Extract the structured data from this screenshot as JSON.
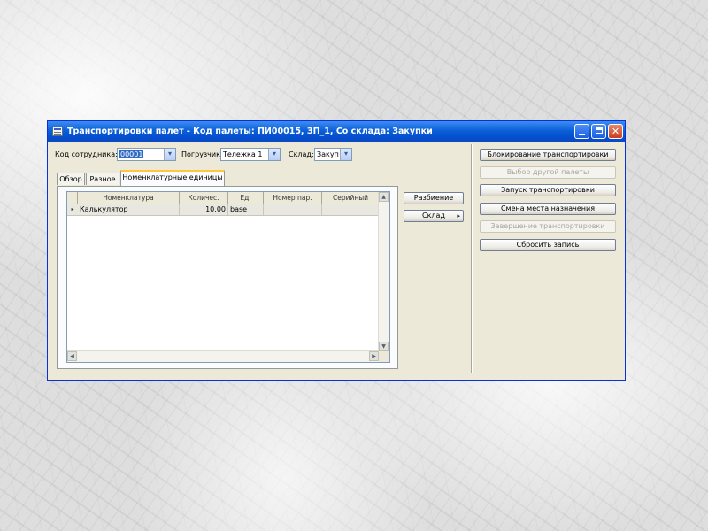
{
  "window": {
    "title": "Транспортировки палет - Код палеты: ПИ00015, ЗП_1, Со склада: Закупки",
    "min_label": "",
    "max_label": "",
    "close_label": "✕"
  },
  "filters": {
    "code_label": "Код сотрудника:",
    "code_value": "00001",
    "loader_label": "Погрузчик:",
    "loader_value": "Тележка 1",
    "warehouse_label": "Склад:",
    "warehouse_value": "Закуп"
  },
  "tabs": [
    "Обзор",
    "Разное",
    "Номенклатурные единицы"
  ],
  "grid": {
    "columns": [
      "Номенклатура",
      "Количес.",
      "Ед.",
      "Номер пар.",
      "Серийный"
    ],
    "rows": [
      {
        "marker": "▸",
        "item": "Калькулятор",
        "qty": "10.00",
        "unit": "base",
        "lot": "",
        "serial": ""
      }
    ]
  },
  "middle_buttons": {
    "split": "Разбиение",
    "warehouse": "Склад",
    "warehouse_arrow": "▸"
  },
  "right_buttons": [
    {
      "label": "Блокирование транспортировки",
      "disabled": false
    },
    {
      "label": "Выбор другой палеты",
      "disabled": true
    },
    {
      "label": "Запуск транспортировки",
      "disabled": false
    },
    {
      "label": "Смена места назначения",
      "disabled": false
    },
    {
      "label": "Завершение транспортировки",
      "disabled": true
    },
    {
      "label": "Сбросить запись",
      "disabled": false
    }
  ],
  "colors": {
    "titlebar": "#0b5fd8",
    "window_bg": "#ece9d8",
    "active_tab_accent": "#ffc83c",
    "selection": "#316ac5"
  }
}
